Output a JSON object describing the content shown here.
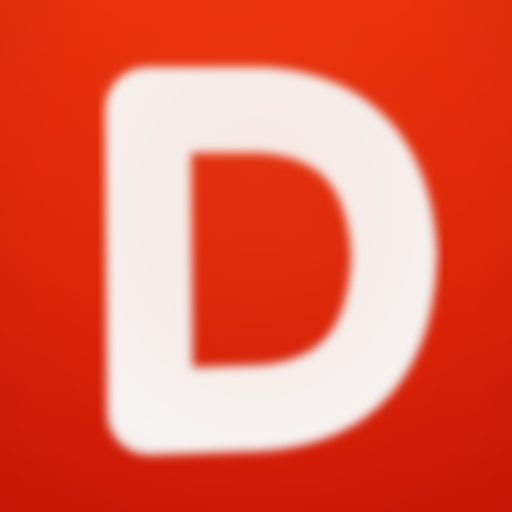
{
  "icon": {
    "letter": "D",
    "glyph_name": "letter-d-icon",
    "colors": {
      "background_top": "#e8320c",
      "background_bottom": "#cf1a06",
      "letter": "#f6f3f2"
    }
  }
}
